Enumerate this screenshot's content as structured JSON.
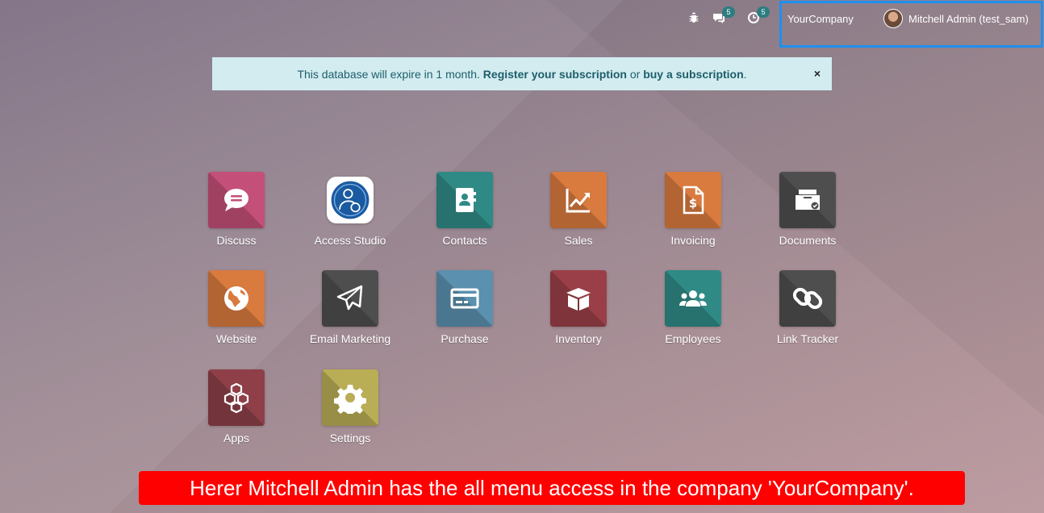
{
  "topbar": {
    "debug_icon": "bug-icon",
    "messages_icon": "chat-icon",
    "messages_count": "5",
    "activities_icon": "clock-icon",
    "activities_count": "5",
    "company": "YourCompany",
    "user": "Mitchell Admin (test_sam)",
    "highlight_color": "#1f8ff0"
  },
  "banner": {
    "text_before": "This database will expire in 1 month.",
    "register_link": "Register your subscription",
    "or": "or",
    "buy_link": "buy a subscription",
    "period": ".",
    "close": "×"
  },
  "apps": [
    {
      "label": "Discuss",
      "icon": "chat-bubble-icon",
      "color": "#c44f78"
    },
    {
      "label": "Access Studio",
      "icon": "user-shield-icon",
      "color": "#1a5aa0"
    },
    {
      "label": "Contacts",
      "icon": "address-book-icon",
      "color": "#2f8a86"
    },
    {
      "label": "Sales",
      "icon": "chart-up-icon",
      "color": "#d97a3e"
    },
    {
      "label": "Invoicing",
      "icon": "invoice-icon",
      "color": "#d97a3e"
    },
    {
      "label": "Documents",
      "icon": "document-box-icon",
      "color": "#4e4e4e"
    },
    {
      "label": "Website",
      "icon": "globe-icon",
      "color": "#d97a3e"
    },
    {
      "label": "Email Marketing",
      "icon": "paper-plane-icon",
      "color": "#4e4e4e"
    },
    {
      "label": "Purchase",
      "icon": "credit-card-icon",
      "color": "#5b90ae"
    },
    {
      "label": "Inventory",
      "icon": "box-icon",
      "color": "#9a3f47"
    },
    {
      "label": "Employees",
      "icon": "users-icon",
      "color": "#2f8a86"
    },
    {
      "label": "Link Tracker",
      "icon": "link-icon",
      "color": "#4e4e4e"
    },
    {
      "label": "Apps",
      "icon": "cubes-icon",
      "color": "#8e3f48"
    },
    {
      "label": "Settings",
      "icon": "gear-icon",
      "color": "#b9ad55"
    }
  ],
  "caption": "Herer Mitchell Admin has the all menu access in the company 'YourCompany'."
}
